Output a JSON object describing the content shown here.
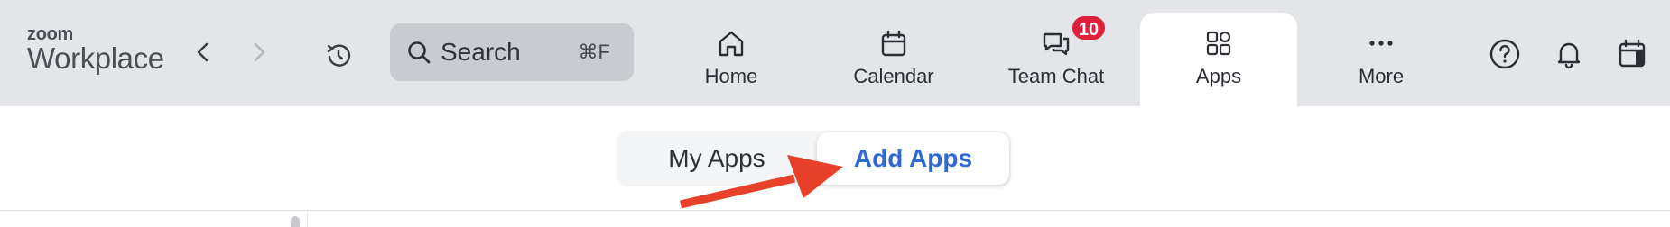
{
  "brand": {
    "line1": "zoom",
    "line2": "Workplace"
  },
  "search": {
    "label": "Search",
    "shortcut": "⌘F"
  },
  "tabs": [
    {
      "label": "Home",
      "icon": "home-icon",
      "active": false
    },
    {
      "label": "Calendar",
      "icon": "calendar-icon",
      "active": false
    },
    {
      "label": "Team Chat",
      "icon": "chat-icon",
      "active": false,
      "badge": "10"
    },
    {
      "label": "Apps",
      "icon": "apps-icon",
      "active": true
    },
    {
      "label": "More",
      "icon": "more-icon",
      "active": false
    }
  ],
  "right_icons": [
    "help-icon",
    "bell-icon",
    "calendar-panel-icon"
  ],
  "segmented": {
    "my_apps": "My Apps",
    "add_apps": "Add Apps",
    "selected": "Add Apps"
  },
  "colors": {
    "topbar": "#e4e5e9",
    "badge": "#e0203b",
    "accent": "#3068d7",
    "arrow": "#e8412b"
  }
}
